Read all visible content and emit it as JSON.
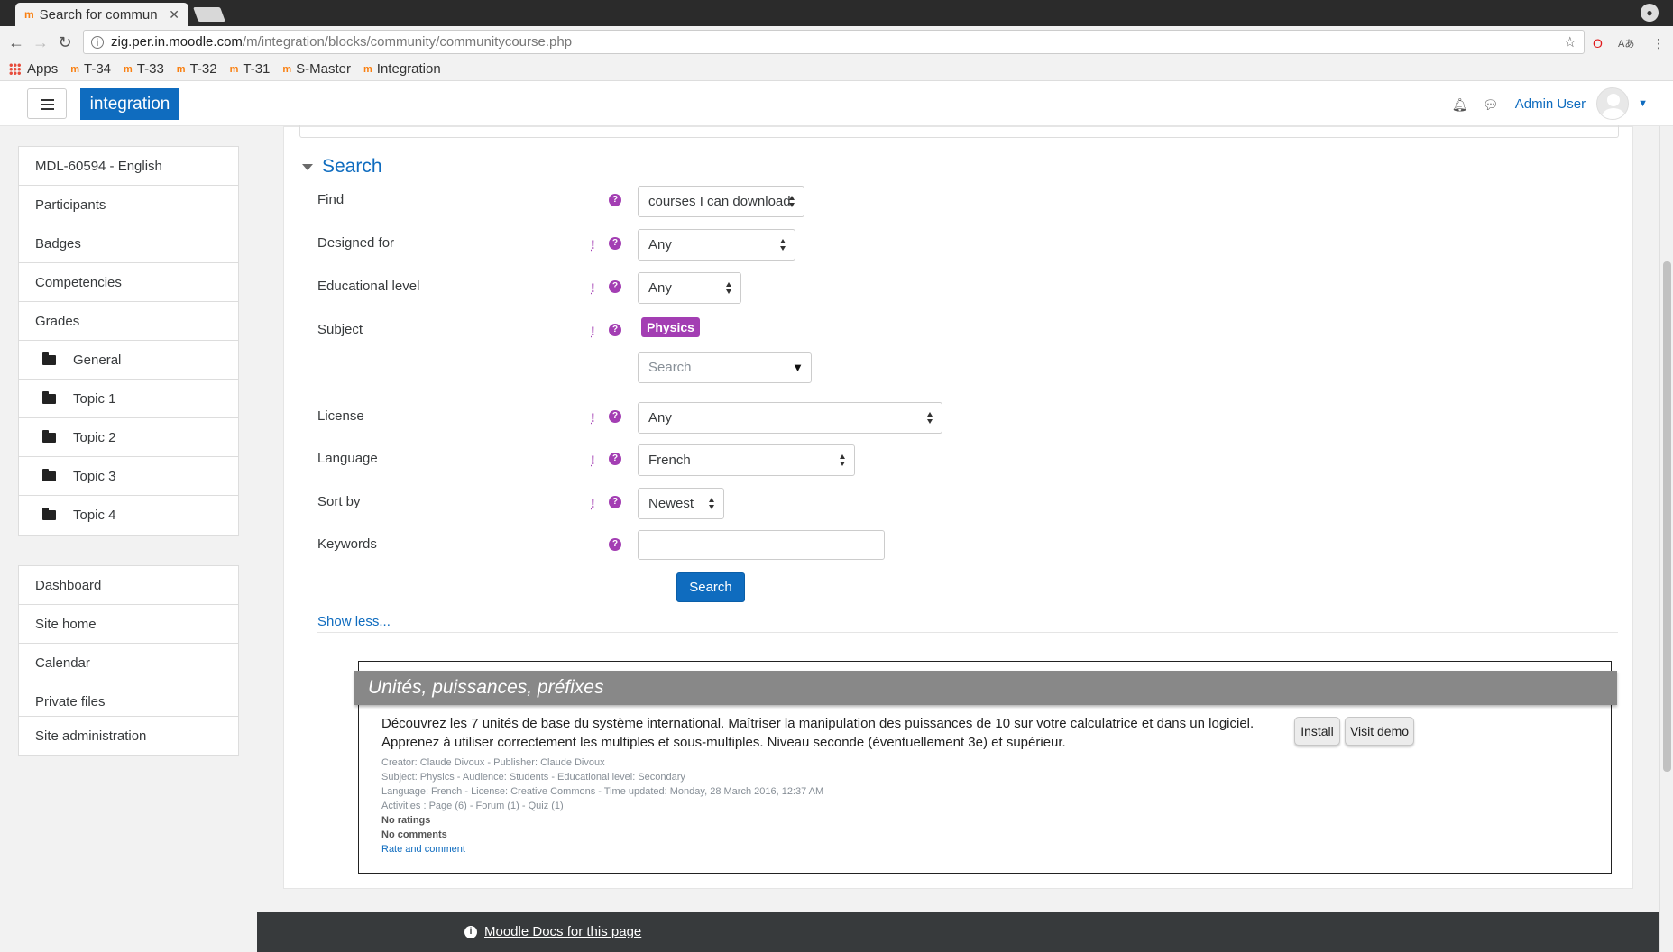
{
  "browser": {
    "tab_title": "Search for commun",
    "tab_favicon": "moodle-favicon",
    "url_host": "zig.per.in.moodle.com",
    "url_path": "/m/integration/blocks/community/communitycourse.php",
    "bookmarks": [
      "Apps",
      "T-34",
      "T-33",
      "T-32",
      "T-31",
      "S-Master",
      "Integration"
    ]
  },
  "navbar": {
    "brand": "integration",
    "username": "Admin User",
    "brand_color": "#0f6cbf"
  },
  "sidebar": {
    "course_items": [
      "MDL-60594 - English",
      "Participants",
      "Badges",
      "Competencies",
      "Grades"
    ],
    "sections": [
      "General",
      "Topic 1",
      "Topic 2",
      "Topic 3",
      "Topic 4"
    ],
    "site_items": [
      "Dashboard",
      "Site home",
      "Calendar",
      "Private files"
    ],
    "admin_item": "Site administration"
  },
  "form": {
    "legend": "Search",
    "find": {
      "label": "Find",
      "value": "courses I can download"
    },
    "designed_for": {
      "label": "Designed for",
      "value": "Any"
    },
    "edu_level": {
      "label": "Educational level",
      "value": "Any"
    },
    "subject": {
      "label": "Subject",
      "tag": "Physics",
      "search_placeholder": "Search"
    },
    "license": {
      "label": "License",
      "value": "Any"
    },
    "language": {
      "label": "Language",
      "value": "French"
    },
    "sort_by": {
      "label": "Sort by",
      "value": "Newest"
    },
    "keywords": {
      "label": "Keywords",
      "value": ""
    },
    "advanced_marker": "!",
    "help_marker": "?",
    "search_button": "Search",
    "show_less": "Show less..."
  },
  "result": {
    "title": "Unités, puissances, préfixes",
    "description_line1": "Découvrez les 7 unités de base du système international. Maîtriser la manipulation des puissances de 10 sur votre calculatrice et dans un logiciel.",
    "description_line2": "Apprenez à utiliser correctement les multiples et sous-multiples. Niveau seconde (éventuellement 3e) et supérieur.",
    "meta_creator": "Creator: Claude Divoux - Publisher: Claude Divoux",
    "meta_subject": "Subject: Physics - Audience: Students - Educational level: Secondary",
    "meta_language": "Language: French - License: Creative Commons - Time updated: Monday, 28 March 2016, 12:37 AM",
    "meta_activities": "Activities : Page (6) - Forum (1) - Quiz (1)",
    "ratings": "No ratings",
    "comments": "No comments",
    "rate_link": "Rate and comment",
    "install_button": "Install",
    "demo_button": "Visit demo"
  },
  "footer": {
    "docs_link": "Moodle Docs for this page"
  }
}
